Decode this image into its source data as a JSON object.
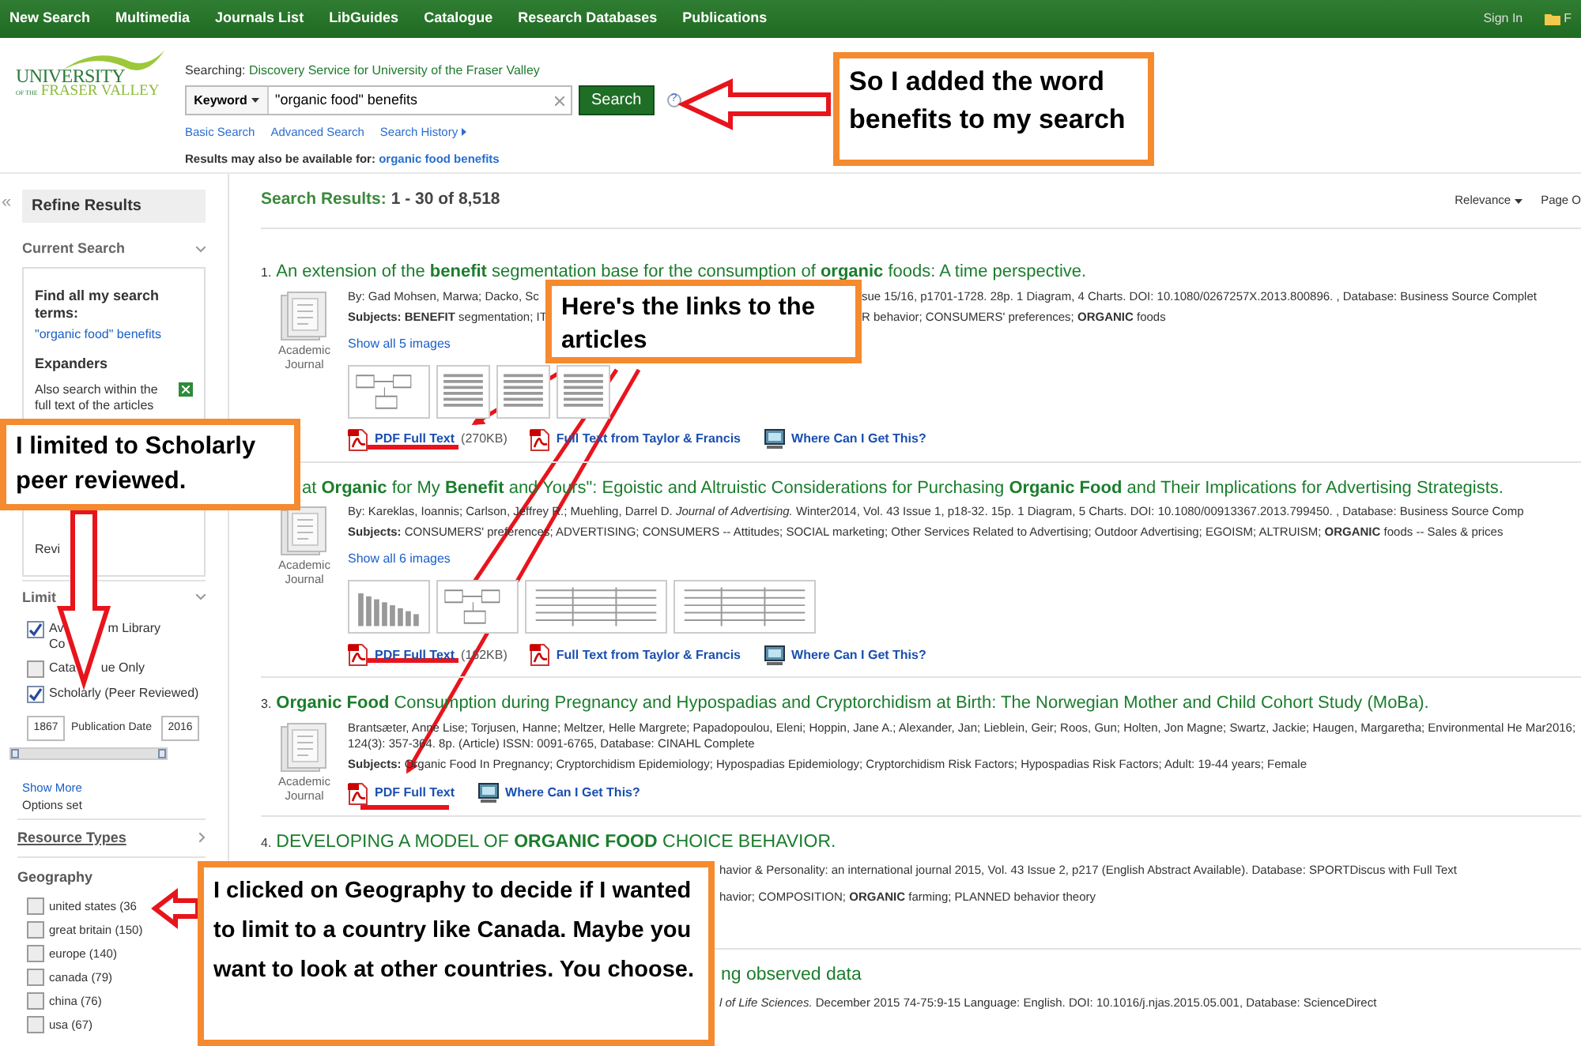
{
  "nav": {
    "items": [
      "New Search",
      "Multimedia",
      "Journals List",
      "LibGuides",
      "Catalogue",
      "Research Databases",
      "Publications"
    ],
    "sign_in": "Sign In",
    "folder": "F"
  },
  "logo": {
    "line1": "UNIVERSITY",
    "line2": "OF THE",
    "line3": "FRASER VALLEY"
  },
  "search": {
    "searching_label": "Searching:",
    "searching_target": "Discovery Service for University of the Fraser Valley",
    "field_type": "Keyword",
    "value": "\"organic food\" benefits",
    "button": "Search",
    "help": "?",
    "links": [
      "Basic Search",
      "Advanced Search",
      "Search History"
    ],
    "also_label": "Results may also be available for:",
    "also_link": "organic food benefits"
  },
  "sidebar": {
    "collapse": "«",
    "title": "Refine Results",
    "current_search": {
      "heading": "Current Search",
      "find_label": "Find all my search terms:",
      "terms": "\"organic food\" benefits",
      "expanders_label": "Expanders",
      "expanders": [
        {
          "label": "Also search within the full text of the articles",
          "on": true
        }
      ],
      "partial": "Revi"
    },
    "limit": {
      "heading": "Limit",
      "options": [
        {
          "lines": [
            [
              "Av",
              "m Library"
            ],
            [
              "Co"
            ]
          ],
          "checked": true
        },
        {
          "lines": [
            [
              "Cata",
              "ue Only"
            ]
          ],
          "checked": false
        },
        {
          "lines": [
            [
              "Scholarly (Peer Reviewed)"
            ]
          ],
          "checked": true
        }
      ],
      "date_from": "1867",
      "date_label": "Publication Date",
      "date_to": "2016",
      "range": {
        "level": 1
      },
      "show_more": "Show More",
      "options_set": "Options set"
    },
    "resource_types": "Resource Types",
    "geography": {
      "heading": "Geography",
      "items": [
        {
          "label": "united states (36",
          "checked": false
        },
        {
          "label": "great britain (150)",
          "checked": false
        },
        {
          "label": "europe (140)",
          "checked": false
        },
        {
          "label": "canada (79)",
          "checked": false
        },
        {
          "label": "china (76)",
          "checked": false
        },
        {
          "label": "usa (67)",
          "checked": false
        }
      ]
    }
  },
  "results": {
    "heading": "Search Results:",
    "range": "1 - 30 of 8,518",
    "sort": "Relevance",
    "page": "Page O",
    "items": [
      {
        "kind": "full",
        "number": "1.",
        "title": "An extension of the **benefit** segmentation base for the consumption of **organic** foods: A time perspective.",
        "type": "Academic Journal",
        "meta": [
          {
            "parts": [
              "By: Gad Mohsen, Marwa; Dacko, Sc",
              "sue 15/16, p1701-1728. 28p. 1 Diagram, 4 Charts. DOI: 10.1080/0267257X.2013.800896. , Database: Business Source Complet"
            ]
          },
          {
            "parts": [
              "**Subjects:** **BENEFIT** segmentation; IT",
              "R behavior; CONSUMERS' preferences; **ORGANIC** foods"
            ]
          }
        ],
        "images_link": "Show all 5 images",
        "thumbnails": [
          {
            "kind": "diagram"
          },
          {
            "kind": "form"
          },
          {
            "kind": "form"
          },
          {
            "kind": "form"
          }
        ],
        "links": [
          {
            "kind": "pdf",
            "label": "PDF Full Text",
            "size": "(270KB)"
          },
          {
            "kind": "pdf",
            "label": "Full Text from Taylor & Francis"
          },
          {
            "kind": "library",
            "label": "Where Can I Get This?"
          }
        ]
      },
      {
        "kind": "offset",
        "title": "at **Organic** for My **Benefit** and Yours\": Egoistic and Altruistic Considerations for Purchasing **Organic Food** and Their Implications for Advertising Strategists.",
        "type": "Academic Journal",
        "meta": [
          {
            "parts": [
              "By: Kareklas, Ioannis; Carlson, Jeffrey R.; Muehling, Darrel D. *Journal of Advertising.* Winter2014, Vol. 43 Issue 1, p18-32. 15p. 1 Diagram, 5 Charts. DOI: 10.1080/00913367.2013.799450. , Database: Business Source Comp"
            ]
          },
          {
            "parts": [
              "**Subjects:** CONSUMERS' preferences; ADVERTISING; CONSUMERS -- Attitudes; SOCIAL marketing; Other Services Related to Advertising; Outdoor Advertising; EGOISM; ALTRUISM; **ORGANIC** foods -- Sales & prices"
            ]
          }
        ],
        "images_link": "Show all 6 images",
        "thumbnails": [
          {
            "kind": "chart"
          },
          {
            "kind": "diagram"
          },
          {
            "kind": "table"
          },
          {
            "kind": "table"
          }
        ],
        "links": [
          {
            "kind": "pdf",
            "label": "PDF Full Text",
            "size": "(162KB)"
          },
          {
            "kind": "pdf",
            "label": "Full Text from Taylor & Francis"
          },
          {
            "kind": "library",
            "label": "Where Can I Get This?"
          }
        ]
      },
      {
        "kind": "full",
        "number": "3.",
        "title": "**Organic Food** Consumption during Pregnancy and Hypospadias and Cryptorchidism at Birth: The Norwegian Mother and Child Cohort Study (MoBa).",
        "type": "Academic Journal",
        "meta": [
          {
            "parts": [
              "Brantsæter, Anne Lise; Torjusen, Hanne; Meltzer, Helle Margrete; Papadopoulou, Eleni; Hoppin, Jane A.; Alexander, Jan; Lieblein, Geir; Roos, Gun; Holten, Jon Magne; Swartz, Jackie; Haugen, Margaretha; Environmental He Mar2016; 124(3): 357-364. 8p. (Article) ISSN: 0091-6765, Database: CINAHL Complete"
            ]
          },
          {
            "parts": [
              "**Subjects:** Organic Food In Pregnancy; Cryptorchidism Epidemiology; Hypospadias Epidemiology; Cryptorchidism Risk Factors; Hypospadias Risk Factors; Adult: 19-44 years; Female"
            ]
          }
        ],
        "links": [
          {
            "kind": "pdf",
            "label": "PDF Full Text"
          },
          {
            "kind": "library",
            "label": "Where Can I Get This?"
          }
        ]
      },
      {
        "kind": "covered",
        "number": "4.",
        "title": "DEVELOPING A MODEL OF **ORGANIC FOOD** CHOICE BEHAVIOR.",
        "meta": [
          {
            "parts": [
              "havior & Personality: an international journal 2015, Vol. 43 Issue 2, p217 (English Abstract Available). Database: SPORTDiscus with Full Text"
            ]
          },
          {
            "parts": [
              "havior; COMPOSITION; **ORGANIC** farming; PLANNED behavior theory"
            ]
          }
        ]
      },
      {
        "kind": "covered",
        "title": "ng observed data",
        "meta": [
          {
            "parts": [
              "*l of Life Sciences.* December 2015 74-75:9-15 Language: English. DOI: 10.1016/j.njas.2015.05.001, Database: ScienceDirect"
            ]
          }
        ]
      }
    ]
  },
  "annotations": [
    {
      "kind": "left-arrow",
      "text": "So I added the word benefits to my search"
    },
    {
      "kind": "pointers",
      "text": "Here's the links to the articles"
    },
    {
      "kind": "down-arrow",
      "text": "I limited to Scholarly peer reviewed."
    },
    {
      "kind": "left-arrow",
      "text": "I clicked on Geography to decide if I wanted to limit to a country like Canada. Maybe you want to look at other countries. You choose."
    }
  ]
}
